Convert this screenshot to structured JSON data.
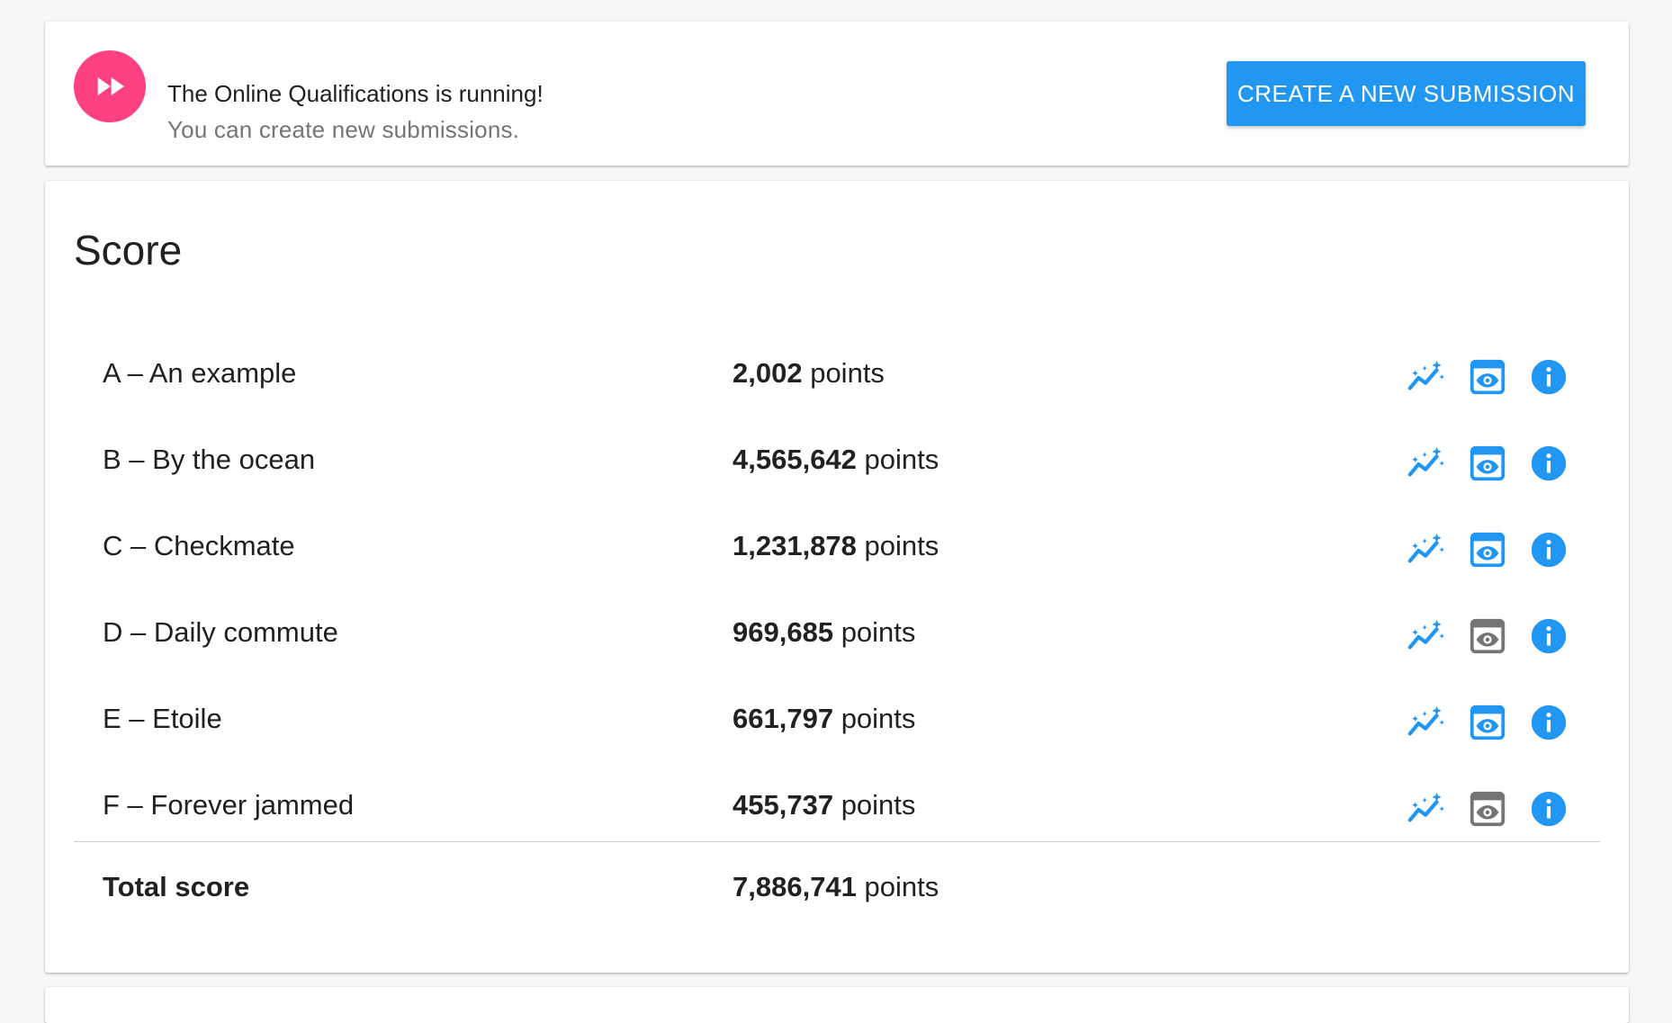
{
  "banner": {
    "icon": "fast-forward-icon",
    "icon_color": "#ff4081",
    "title": "The Online Qualifications is running!",
    "subtitle": "You can create new submissions.",
    "button_label": "CREATE A NEW SUBMISSION",
    "button_color": "#2196f3"
  },
  "score": {
    "heading": "Score",
    "points_unit": "points",
    "accent_color": "#2196f3",
    "disabled_color": "#757575",
    "tasks": [
      {
        "name": "A – An example",
        "points": "2,002",
        "view_enabled": true
      },
      {
        "name": "B – By the ocean",
        "points": "4,565,642",
        "view_enabled": true
      },
      {
        "name": "C – Checkmate",
        "points": "1,231,878",
        "view_enabled": true
      },
      {
        "name": "D – Daily commute",
        "points": "969,685",
        "view_enabled": false
      },
      {
        "name": "E – Etoile",
        "points": "661,797",
        "view_enabled": true
      },
      {
        "name": "F – Forever jammed",
        "points": "455,737",
        "view_enabled": false
      }
    ],
    "total_label": "Total score",
    "total_points": "7,886,741"
  }
}
